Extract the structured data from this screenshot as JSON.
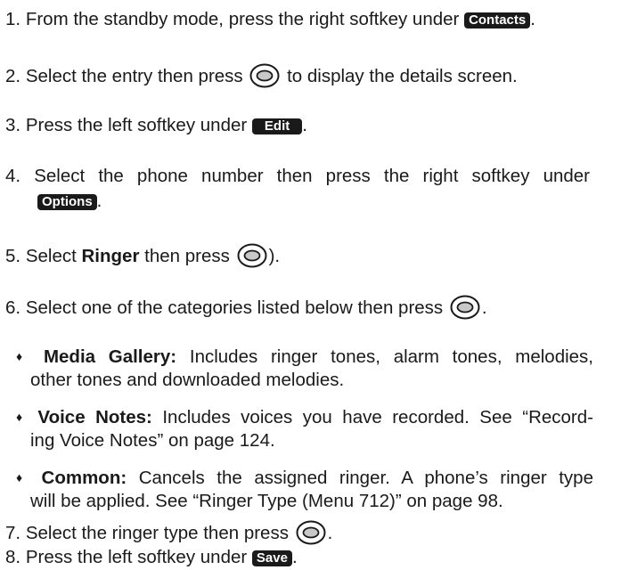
{
  "steps": {
    "s1": {
      "num": "1.",
      "text": "From the standby mode, press the right softkey under",
      "badge": "Contacts",
      "end": "."
    },
    "s2": {
      "num": "2.",
      "before": "Select the entry then press",
      "after": "to display the details screen."
    },
    "s3": {
      "num": "3.",
      "text": "Press the left softkey under",
      "badge": "Edit",
      "end": "."
    },
    "s4": {
      "num": "4.",
      "text": "Select the phone number then press the right softkey under",
      "badge": "Options",
      "end": "."
    },
    "s5": {
      "num": "5.",
      "before": "Select",
      "bold": "Ringer",
      "after": "then press",
      "end": ")."
    },
    "s6": {
      "num": "6.",
      "before": "Select one of the categories listed below then press",
      "end": "."
    },
    "s7": {
      "num": "7.",
      "before": "Select the ringer type then press",
      "end": "."
    },
    "s8": {
      "num": "8.",
      "text": "Press the left softkey under",
      "badge": "Save",
      "end": "."
    }
  },
  "bullets": {
    "b1": {
      "marker": "♦",
      "label": "Media Gallery:",
      "line1": "Includes ringer tones, alarm tones, melodies,",
      "line2": "other tones and downloaded melodies."
    },
    "b2": {
      "marker": "♦",
      "label": "Voice Notes:",
      "line1": "Includes voices you have recorded. See “Record-",
      "line2": "ing Voice Notes” on page 124."
    },
    "b3": {
      "marker": "♦",
      "label": "Common:",
      "line1": "Cancels the assigned ringer. A phone’s ringer type",
      "line2": "will be applied. See “Ringer Type (Menu 712)” on page 98."
    }
  },
  "icons": {
    "ok_key": "ok-key-icon"
  }
}
